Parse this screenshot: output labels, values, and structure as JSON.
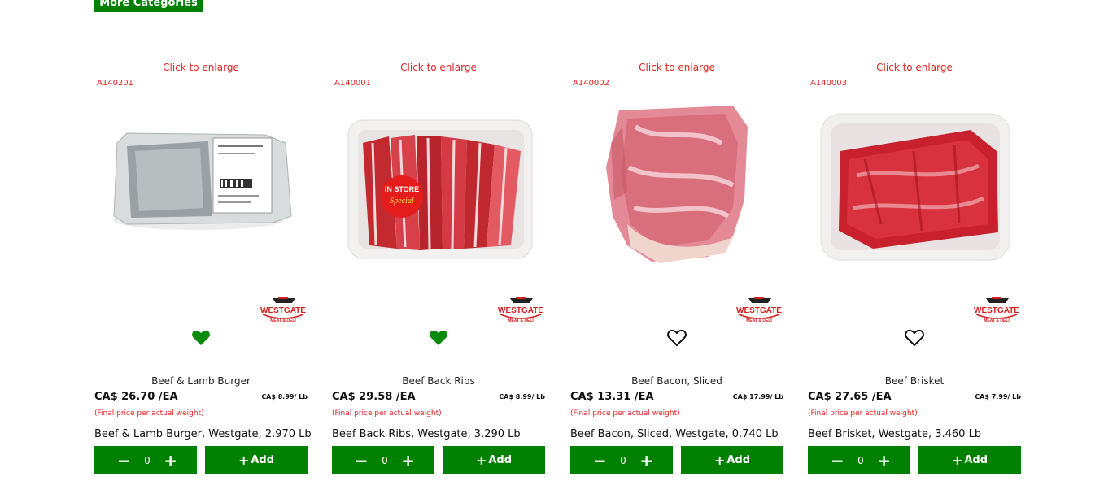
{
  "header": {
    "more_categories_label": "More Categories"
  },
  "common": {
    "enlarge_label": "Click to enlarge",
    "final_note": "(Final price per actual weight)",
    "add_label": "Add",
    "minus_symbol": "−",
    "plus_symbol": "+",
    "logo_text": "WESTGATE",
    "logo_sub": "MEAT & DELI",
    "brand_color": "#008000",
    "accent_color": "#e32323"
  },
  "products": [
    {
      "sku": "A140201",
      "name": "Beef & Lamb Burger",
      "price": "CA$ 26.70 /EA",
      "unit_price": "CA$ 8.99/ Lb",
      "desc": "Beef & Lamb Burger, Westgate, 2.970 Lb",
      "qty": "0",
      "favorite": true,
      "sticker": ""
    },
    {
      "sku": "A140001",
      "name": "Beef Back Ribs",
      "price": "CA$ 29.58 /EA",
      "unit_price": "CA$ 8.99/ Lb",
      "desc": "Beef Back Ribs, Westgate, 3.290 Lb",
      "qty": "0",
      "favorite": true,
      "sticker": "IN STORE Special"
    },
    {
      "sku": "A140002",
      "name": "Beef Bacon, Sliced",
      "price": "CA$ 13.31 /EA",
      "unit_price": "CA$ 17.99/ Lb",
      "desc": "Beef Bacon, Sliced, Westgate, 0.740 Lb",
      "qty": "0",
      "favorite": false,
      "sticker": ""
    },
    {
      "sku": "A140003",
      "name": "Beef Brisket",
      "price": "CA$ 27.65 /EA",
      "unit_price": "CA$ 7.99/ Lb",
      "desc": "Beef Brisket, Westgate, 3.460 Lb",
      "qty": "0",
      "favorite": false,
      "sticker": ""
    }
  ]
}
